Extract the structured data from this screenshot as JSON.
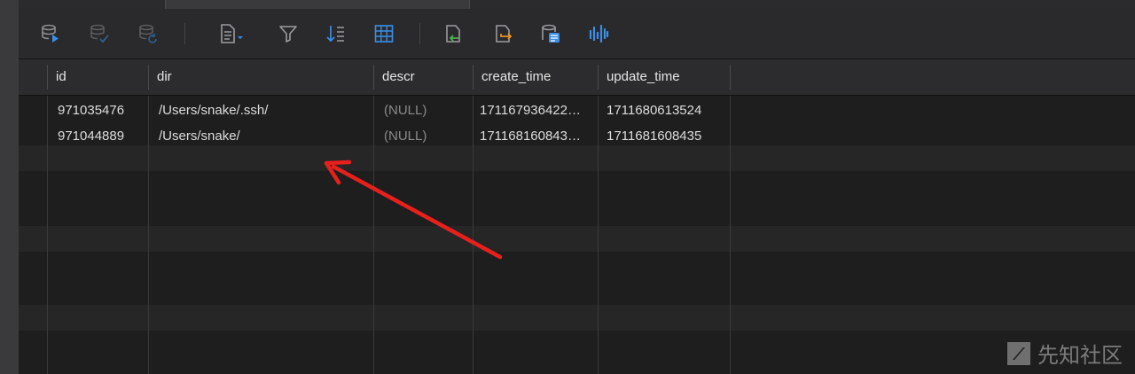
{
  "toolbar": {
    "icons": [
      "db-run-icon",
      "db-commit-icon",
      "db-revert-icon",
      "document-menu-icon",
      "filter-icon",
      "sort-icon",
      "grid-icon",
      "import-icon",
      "export-icon",
      "text-view-icon",
      "chart-icon"
    ]
  },
  "table": {
    "columns": [
      "id",
      "dir",
      "descr",
      "create_time",
      "update_time"
    ],
    "rows": [
      {
        "id": "971035476",
        "dir": "/Users/snake/.ssh/",
        "descr": "(NULL)",
        "create_time": "171167936422…",
        "update_time": "1711680613524"
      },
      {
        "id": "971044889",
        "dir": "/Users/snake/",
        "descr": "(NULL)",
        "create_time": "171168160843…",
        "update_time": "1711681608435"
      }
    ]
  },
  "watermark": {
    "text": "先知社区"
  },
  "colors": {
    "accent_blue": "#3a8ee6",
    "arrow_red": "#e8201c",
    "header_bg": "#2c2c2e",
    "grid_bg": "#1e1e1e"
  }
}
